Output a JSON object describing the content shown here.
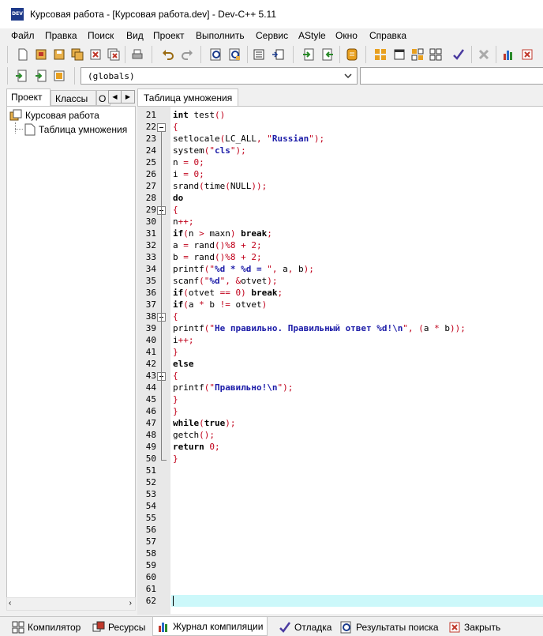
{
  "window": {
    "title": "Курсовая работа - [Курсовая работа.dev] - Dev-C++ 5.11",
    "icon": "dev-cpp-icon",
    "icon_text": "DEV"
  },
  "menu": [
    "Файл",
    "Правка",
    "Поиск",
    "Вид",
    "Проект",
    "Выполнить",
    "Сервис",
    "AStyle",
    "Окно",
    "Справка"
  ],
  "toolbar": {
    "scope_combo": "(globals)",
    "buttons": [
      "new-file-icon",
      "open-icon",
      "save-icon",
      "save-all-icon",
      "close-icon",
      "close-all-icon",
      "print-icon",
      "undo-icon",
      "redo-icon",
      "find-icon",
      "replace-icon",
      "indent-icon",
      "unindent-icon",
      "goto-icon",
      "bookmark-icon",
      "class-icon",
      "compile-icon",
      "run-icon",
      "compile-run-icon",
      "rebuild-icon",
      "check-icon",
      "stop-icon",
      "chart-icon",
      "debug-icon",
      "add-to-project-icon",
      "remove-from-project-icon",
      "project-options-icon"
    ]
  },
  "left_panel": {
    "tabs": [
      "Проект",
      "Классы",
      "О"
    ],
    "tree": {
      "root": "Курсовая работа",
      "child": "Таблица умножения"
    }
  },
  "editor": {
    "tab": "Таблица умножения",
    "lines": [
      {
        "n": 21,
        "code": "int test()"
      },
      {
        "n": 22,
        "code": "{"
      },
      {
        "n": 23,
        "code": "setlocale(LC_ALL, \"Russian\");"
      },
      {
        "n": 24,
        "code": "system(\"cls\");"
      },
      {
        "n": 25,
        "code": "n = 0;"
      },
      {
        "n": 26,
        "code": "i = 0;"
      },
      {
        "n": 27,
        "code": "srand(time(NULL));"
      },
      {
        "n": 28,
        "code": "do"
      },
      {
        "n": 29,
        "code": "{"
      },
      {
        "n": 30,
        "code": "n++;"
      },
      {
        "n": 31,
        "code": "if(n > maxn) break;"
      },
      {
        "n": 32,
        "code": "a = rand()%8 + 2;"
      },
      {
        "n": 33,
        "code": "b = rand()%8 + 2;"
      },
      {
        "n": 34,
        "code": "printf(\"%d * %d = \", a, b);"
      },
      {
        "n": 35,
        "code": "scanf(\"%d\", &otvet);"
      },
      {
        "n": 36,
        "code": "if(otvet == 0) break;"
      },
      {
        "n": 37,
        "code": "if(a * b != otvet)"
      },
      {
        "n": 38,
        "code": "{"
      },
      {
        "n": 39,
        "code": "printf(\"Не правильно. Правильный ответ %d!\\n\", (a * b));"
      },
      {
        "n": 40,
        "code": "i++;"
      },
      {
        "n": 41,
        "code": "}"
      },
      {
        "n": 42,
        "code": "else"
      },
      {
        "n": 43,
        "code": "{"
      },
      {
        "n": 44,
        "code": "printf(\"Правильно!\\n\");"
      },
      {
        "n": 45,
        "code": "}"
      },
      {
        "n": 46,
        "code": "}"
      },
      {
        "n": 47,
        "code": "while(true);"
      },
      {
        "n": 48,
        "code": "getch();"
      },
      {
        "n": 49,
        "code": "return 0;"
      },
      {
        "n": 50,
        "code": "}"
      },
      {
        "n": 51,
        "code": ""
      },
      {
        "n": 52,
        "code": ""
      },
      {
        "n": 53,
        "code": ""
      },
      {
        "n": 54,
        "code": ""
      },
      {
        "n": 55,
        "code": ""
      },
      {
        "n": 56,
        "code": ""
      },
      {
        "n": 57,
        "code": ""
      },
      {
        "n": 58,
        "code": ""
      },
      {
        "n": 59,
        "code": ""
      },
      {
        "n": 60,
        "code": ""
      },
      {
        "n": 61,
        "code": ""
      },
      {
        "n": 62,
        "code": ""
      }
    ],
    "fold_markers": [
      22,
      29,
      38,
      43
    ],
    "current_line": 62
  },
  "bottom_tabs": [
    "Компилятор",
    "Ресурсы",
    "Журнал компиляции",
    "Отладка",
    "Результаты поиска",
    "Закрыть"
  ],
  "bottom_active": "Журнал компиляции"
}
